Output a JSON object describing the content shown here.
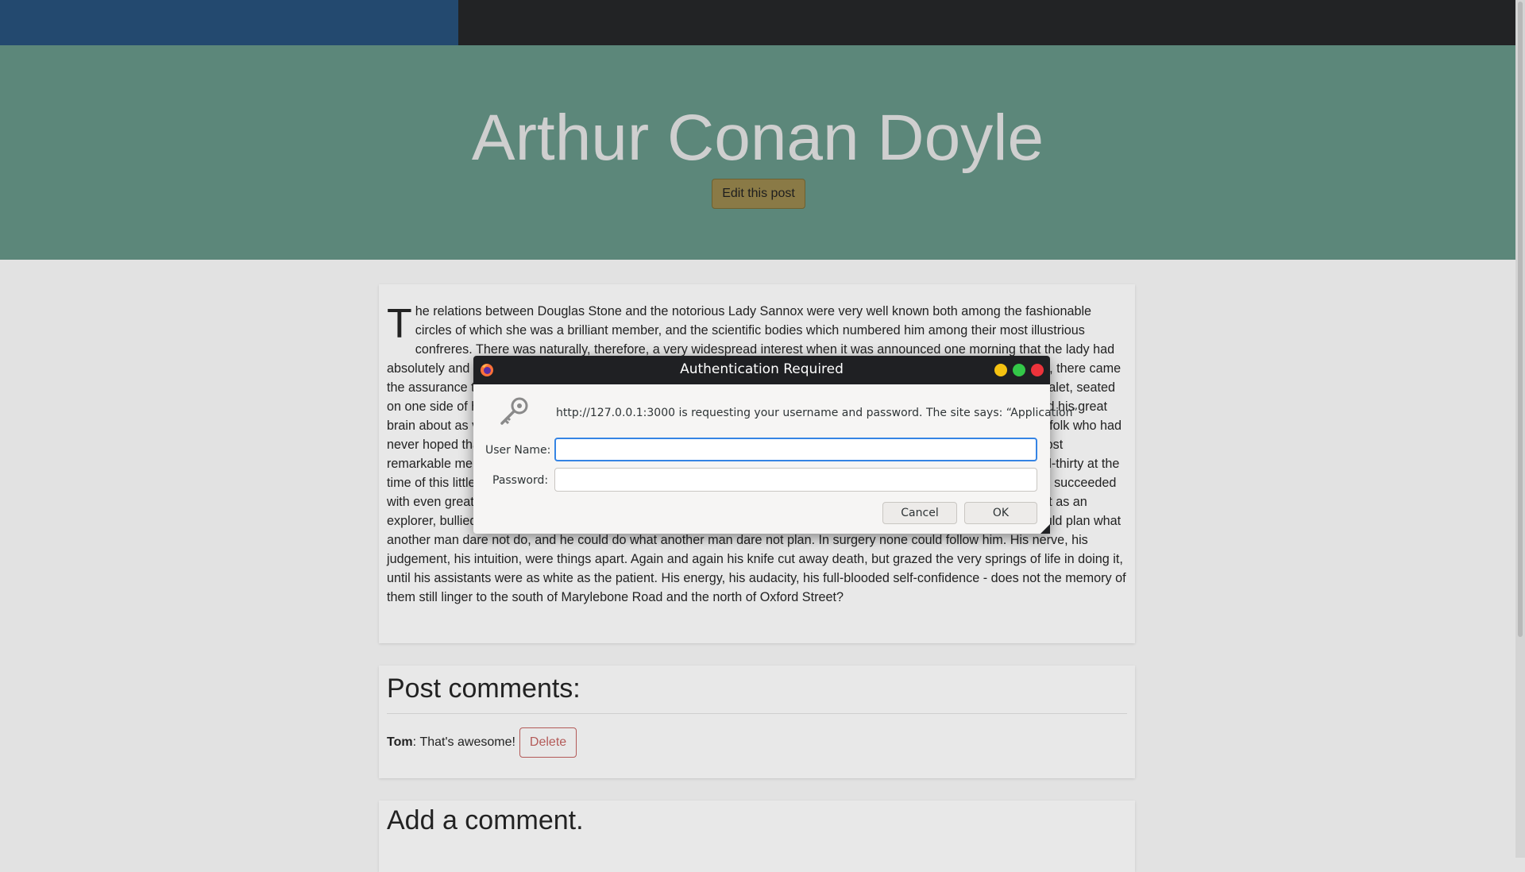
{
  "hero": {
    "title": "Arthur Conan Doyle",
    "edit_button": "Edit this post"
  },
  "article": {
    "dropcap": "T",
    "text": "he relations between Douglas Stone and the notorious Lady Sannox were very well known both among the fashionable circles of which she was a brilliant member, and the scientific bodies which numbered him among their most illustrious confreres. There was naturally, therefore, a very widespread interest when it was announced one morning that the lady had absolutely and for ever taken the veil, and that the world would see her no more. When, at the very tail of this rumour, there came the assurance that the celebrated operating surgeon, the man of iron nerves, had been found in the morning by his valet, seated on one side of his bed, smiling pleasantly upon the universe, with both legs jammed into one side of his breeches and his great brain about as valuable as a cap full of porridge, the matter was strong enough to give quite a little thrill of interest to folk who had never hoped that their jaded nerves were capable of such a sensation. Douglas Stone in his prime was one of the most remarkable men in England. Indeed, he could hardly be said to have ever reached his prime, for he was but nine-and-thirty at the time of this little incident. Those who knew him best were aware that, famous as he was as a surgeon, he might have succeeded with even greater rapidity in any of a dozen lines of life. He could have cut his way to fame as a soldier, struggled to it as an explorer, bullied for it in the courts, or built it out of stone and iron as an engineer. He was born to be great, for he could plan what another man dare not do, and he could do what another man dare not plan. In surgery none could follow him. His nerve, his judgement, his intuition, were things apart. Again and again his knife cut away death, but grazed the very springs of life in doing it, until his assistants were as white as the patient. His energy, his audacity, his full-blooded self-confidence - does not the memory of them still linger to the south of Marylebone Road and the north of Oxford Street?"
  },
  "comments": {
    "title": "Post comments:",
    "items": [
      {
        "author": "Tom",
        "separator": ": ",
        "text": "That's awesome!",
        "delete_label": "Delete"
      }
    ]
  },
  "add_comment": {
    "title": "Add a comment."
  },
  "dialog": {
    "title": "Authentication Required",
    "message": "http://127.0.0.1:3000 is requesting your username and password. The site says: “Application”",
    "username_label": "User Name:",
    "username_value": "",
    "password_label": "Password:",
    "password_value": "",
    "cancel_label": "Cancel",
    "ok_label": "OK",
    "icons": {
      "app": "firefox-icon",
      "prompt": "key-icon"
    }
  },
  "colors": {
    "topbar": "#222325",
    "topbar_left": "#23496f",
    "hero": "#5c877a",
    "edit_button": "#8a7a46",
    "delete_button": "#b35a58",
    "focus": "#3584e4"
  }
}
